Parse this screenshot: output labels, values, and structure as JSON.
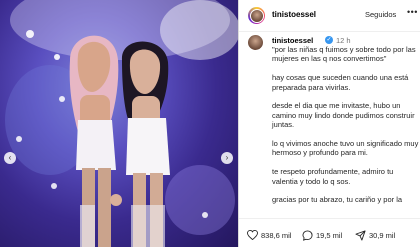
{
  "post": {
    "username": "tinistoessel",
    "follow_label": "Seguidos",
    "more_glyph": "•••",
    "time_ago": "12 h",
    "verified_glyph": "✓",
    "caption_paragraphs": [
      "\"por las niñas q fuimos y sobre todo por las mujeres en las q nos convertimos\"",
      "hay cosas que suceden cuando una está preparada para vivirlas.",
      "desde el dia que me invitaste, hubo un camino muy lindo donde pudimos construir juntas.",
      "lo q vivimos anoche tuvo un significado muy hermoso y profundo para mi.",
      "te respeto profundamente, admiro tu valentia y todo lo q sos.",
      "gracias por tu abrazo, tu cariño y por la"
    ]
  },
  "carousel": {
    "prev_glyph": "‹",
    "next_glyph": "›"
  },
  "actions": {
    "likes": "838,6 mil",
    "comments": "19,5 mil",
    "shares": "30,9 mil"
  },
  "icons": {
    "like": "heart-icon",
    "comment": "comment-icon",
    "share": "share-icon",
    "more": "more-options-icon"
  },
  "colors": {
    "verified": "#3897f0",
    "stage_light": "#7e82d6",
    "stage_dark": "#24175e"
  }
}
